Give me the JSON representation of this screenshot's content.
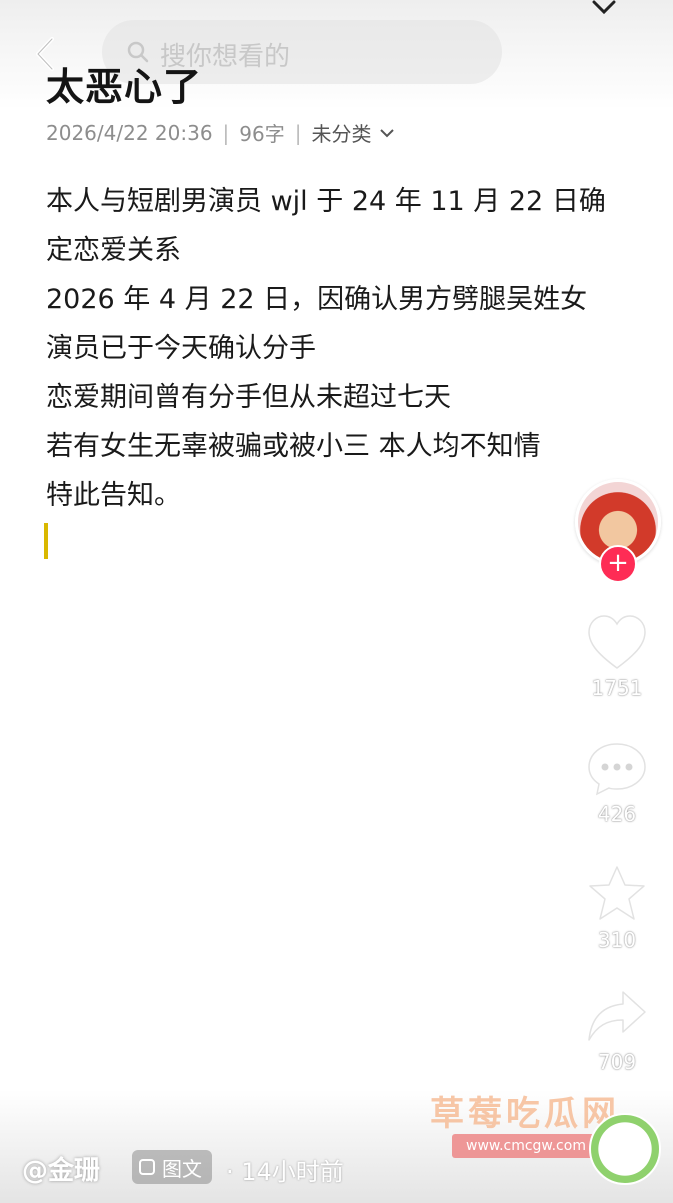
{
  "search": {
    "placeholder": "搜你想看的"
  },
  "note": {
    "title": "太恶心了",
    "date": "2026/4/22 20:36",
    "word_count": "96字",
    "category": "未分类",
    "lines": [
      "本人与短剧男演员 wjl 于 24 年 11 月 22 日确",
      "定恋爱关系",
      "2026 年 4 月 22 日，因确认男方劈腿吴姓女",
      "演员已于今天确认分手",
      "恋爱期间曾有分手但从未超过七天",
      "若有女生无辜被骗或被小三 本人均不知情",
      "特此告知。"
    ]
  },
  "actions": {
    "likes": "1751",
    "comments": "426",
    "favorites": "310",
    "shares": "709",
    "follow_label": "+"
  },
  "post": {
    "author": "@金珊",
    "type_label": "图文",
    "time": "· 14小时前"
  },
  "watermark": {
    "title": "草莓吃瓜网",
    "url": "www.cmcgw.com"
  },
  "colors": {
    "cursor": "#d9b800",
    "follow": "#fe2c55",
    "watermark_title": "#f6bc96",
    "watermark_url_bg": "#ec7878"
  },
  "icons": [
    "back-arrow-icon",
    "search-icon",
    "chevron-down-icon",
    "heart-icon",
    "comment-icon",
    "star-icon",
    "share-icon",
    "image-text-icon"
  ]
}
